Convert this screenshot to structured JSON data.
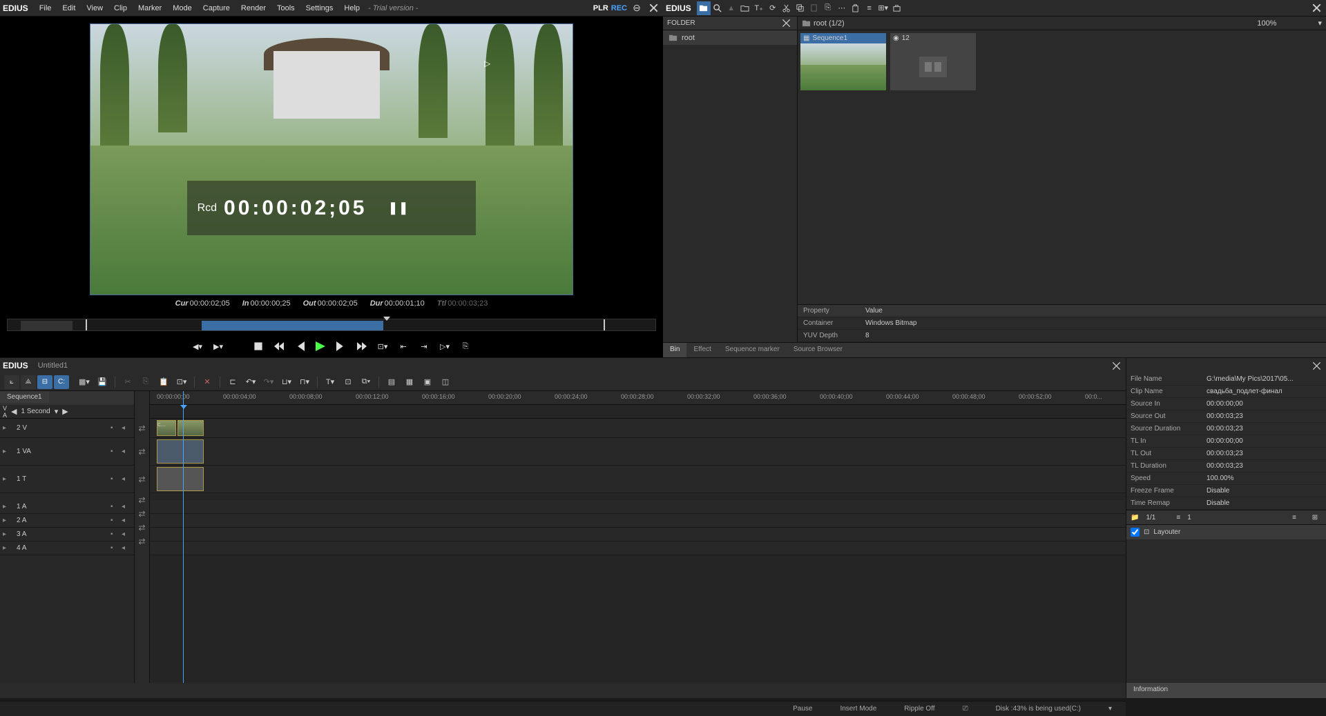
{
  "app": {
    "brand": "EDIUS"
  },
  "menu": {
    "items": [
      "File",
      "Edit",
      "View",
      "Clip",
      "Marker",
      "Mode",
      "Capture",
      "Render",
      "Tools",
      "Settings",
      "Help"
    ],
    "trial": "- Trial version -",
    "plr": "PLR",
    "rec": "REC"
  },
  "preview": {
    "rcd_label": "Rcd",
    "rcd_time": "00:00:02;05",
    "tc": {
      "cur_l": "Cur",
      "cur": "00:00:02;05",
      "in_l": "In",
      "in": "00:00:00;25",
      "out_l": "Out",
      "out": "00:00:02;05",
      "dur_l": "Dur",
      "dur": "00:00:01;10",
      "ttl_l": "Ttl",
      "ttl": "00:00:03;23"
    }
  },
  "bin": {
    "folder_header": "FOLDER",
    "root_label": "root",
    "breadcrumb": "root (1/2)",
    "zoom": "100%",
    "thumbs": [
      {
        "title": "Sequence1",
        "icon": "seq"
      },
      {
        "title": "12",
        "icon": "img"
      }
    ],
    "properties": [
      {
        "key": "Property",
        "value": "Value"
      },
      {
        "key": "Container",
        "value": "Windows Bitmap"
      },
      {
        "key": "YUV Depth",
        "value": "8"
      }
    ],
    "tabs": [
      "Bin",
      "Effect",
      "Sequence marker",
      "Source Browser"
    ]
  },
  "timeline": {
    "title": "Untitled1",
    "seq_tab": "Sequence1",
    "scale": "1 Second",
    "va_v": "V",
    "va_a": "A",
    "tracks": [
      {
        "name": "2 V",
        "h": "h28"
      },
      {
        "name": "1 VA",
        "h": "h40"
      },
      {
        "name": "1 T",
        "h": "h40"
      },
      {
        "name": "1 A",
        "h": "h20"
      },
      {
        "name": "2 A",
        "h": "h20"
      },
      {
        "name": "3 A",
        "h": "h20"
      },
      {
        "name": "4 A",
        "h": "h20"
      }
    ],
    "ruler": [
      "00:00:00;00",
      "00:00:04;00",
      "00:00:08;00",
      "00:00:12;00",
      "00:00:16;00",
      "00:00:20;00",
      "00:00:24;00",
      "00:00:28;00",
      "00:00:32;00",
      "00:00:36;00",
      "00:00:40;00",
      "00:00:44;00",
      "00:00:48;00",
      "00:00:52;00",
      "00:0..."
    ],
    "clip_label": "с..."
  },
  "status": {
    "pause": "Pause",
    "insert": "Insert Mode",
    "ripple": "Ripple Off",
    "disk": "Disk :43% is being used(C:)"
  },
  "info": {
    "rows": [
      {
        "key": "File Name",
        "value": "G:\\media\\My Pics\\2017\\05..."
      },
      {
        "key": "Clip Name",
        "value": "свадьба_подлет-финал"
      },
      {
        "key": "Source In",
        "value": "00:00:00;00"
      },
      {
        "key": "Source Out",
        "value": "00:00:03;23"
      },
      {
        "key": "Source Duration",
        "value": "00:00:03;23"
      },
      {
        "key": "TL In",
        "value": "00:00:00;00"
      },
      {
        "key": "TL Out",
        "value": "00:00:03;23"
      },
      {
        "key": "TL Duration",
        "value": "00:00:03;23"
      },
      {
        "key": "Speed",
        "value": "100.00%"
      },
      {
        "key": "Freeze Frame",
        "value": "Disable"
      },
      {
        "key": "Time Remap",
        "value": "Disable"
      }
    ],
    "counter1": "1/1",
    "counter2": "1",
    "layouter": "Layouter",
    "tab": "Information"
  }
}
